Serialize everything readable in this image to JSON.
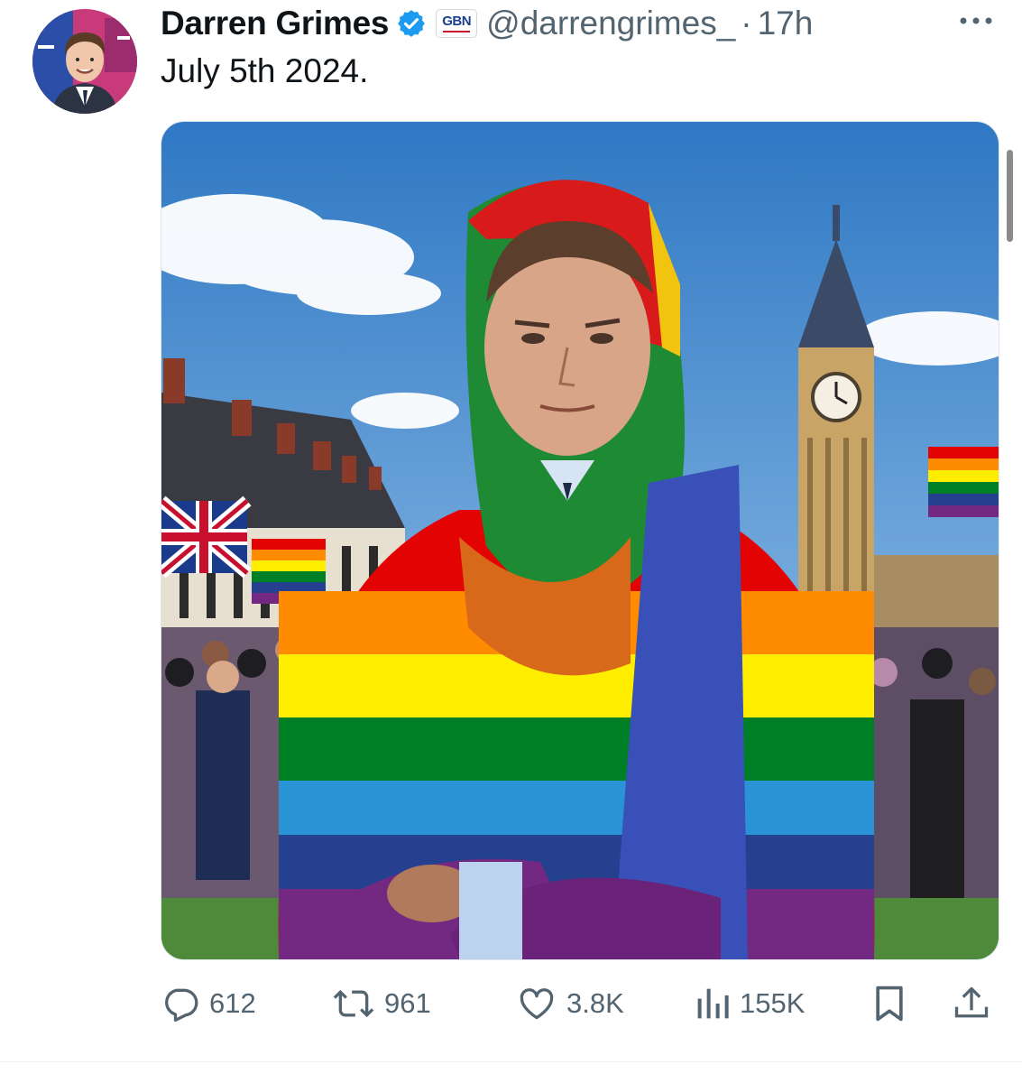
{
  "tweet": {
    "author_name": "Darren Grimes",
    "org_badge": "GBN",
    "handle": "@darrengrimes_",
    "separator": "·",
    "time": "17h",
    "text": "July 5th 2024."
  },
  "actions": {
    "replies": "612",
    "reposts": "961",
    "likes": "3.8K",
    "views": "155K"
  },
  "colors": {
    "verified": "#1d9bf0",
    "text_primary": "#0f1419",
    "text_secondary": "#536471"
  },
  "icons": [
    "verified-badge-icon",
    "more-icon",
    "reply-icon",
    "repost-icon",
    "like-icon",
    "views-icon",
    "bookmark-icon",
    "share-icon"
  ]
}
